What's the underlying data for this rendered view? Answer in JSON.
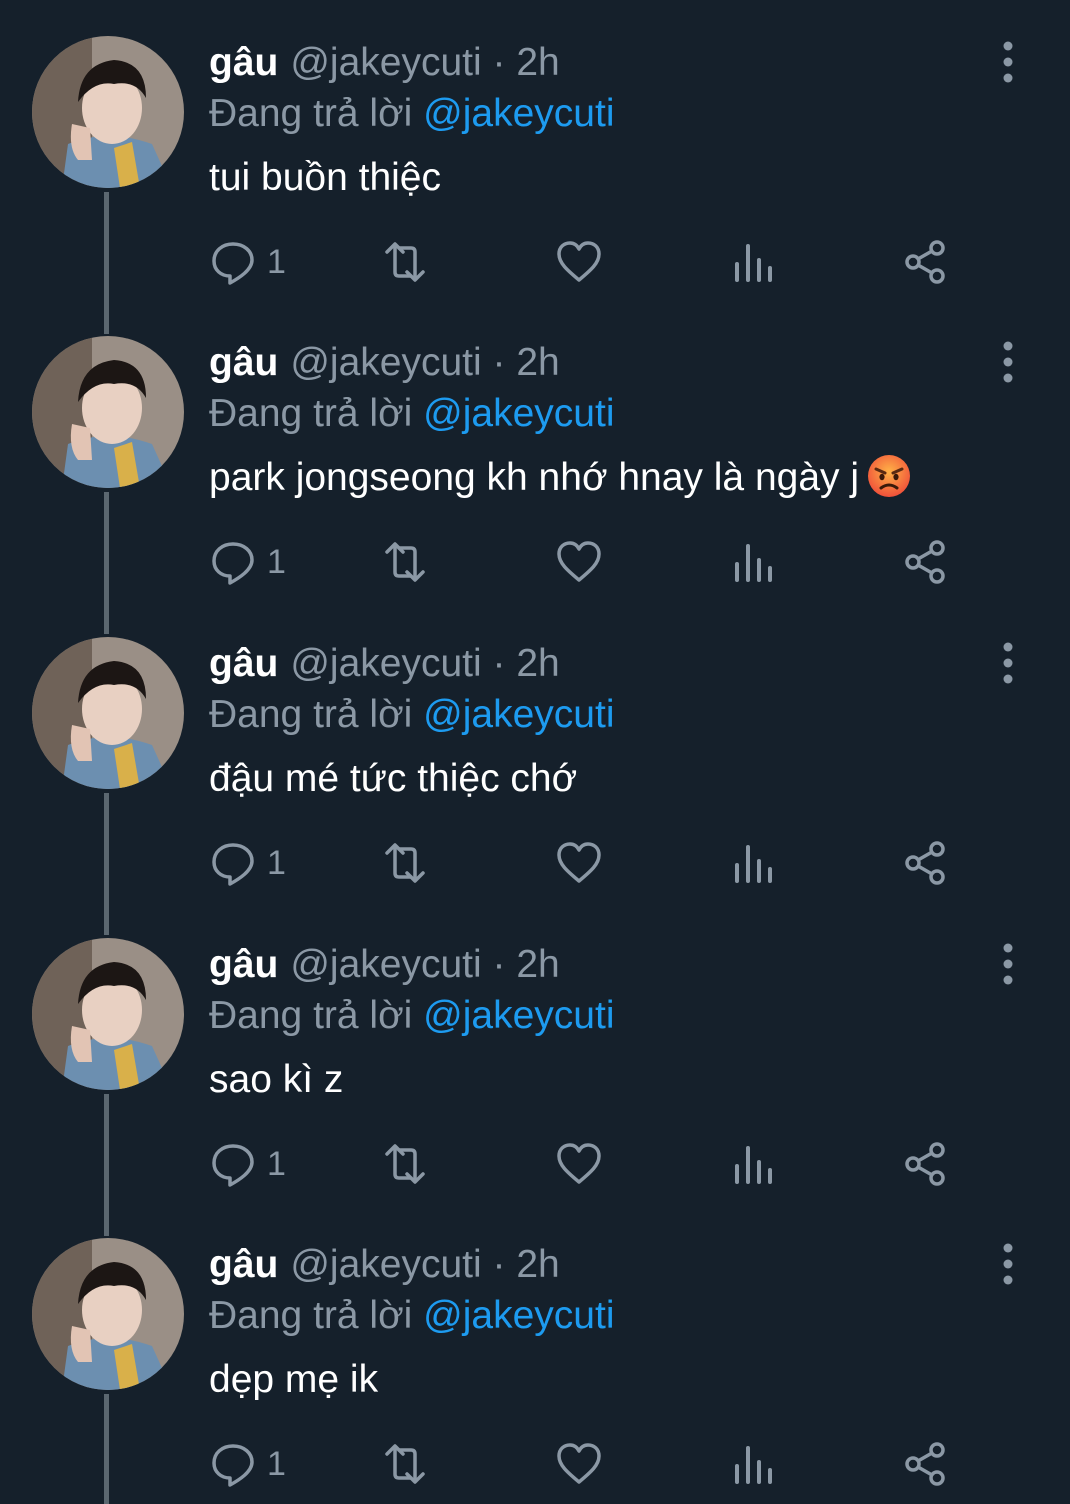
{
  "tweets": [
    {
      "name": "gâu",
      "handle": "@jakeycuti",
      "separator": "·",
      "time": "2h",
      "replying_prefix": "Đang trả lời",
      "replying_to": "@jakeycuti",
      "text": "tui buồn thiệc",
      "reply_count": "1",
      "emoji": ""
    },
    {
      "name": "gâu",
      "handle": "@jakeycuti",
      "separator": "·",
      "time": "2h",
      "replying_prefix": "Đang trả lời",
      "replying_to": "@jakeycuti",
      "text": "park jongseong kh nhớ hnay là ngày j",
      "reply_count": "1",
      "emoji": "angry-face-emoji"
    },
    {
      "name": "gâu",
      "handle": "@jakeycuti",
      "separator": "·",
      "time": "2h",
      "replying_prefix": "Đang trả lời",
      "replying_to": "@jakeycuti",
      "text": "đậu mé tức thiệc chớ",
      "reply_count": "1",
      "emoji": ""
    },
    {
      "name": "gâu",
      "handle": "@jakeycuti",
      "separator": "·",
      "time": "2h",
      "replying_prefix": "Đang trả lời",
      "replying_to": "@jakeycuti",
      "text": "sao kì z",
      "reply_count": "1",
      "emoji": ""
    },
    {
      "name": "gâu",
      "handle": "@jakeycuti",
      "separator": "·",
      "time": "2h",
      "replying_prefix": "Đang trả lời",
      "replying_to": "@jakeycuti",
      "text": "dẹp mẹ ik",
      "reply_count": "1",
      "emoji": ""
    }
  ],
  "icons": {
    "reply": "reply-icon",
    "retweet": "retweet-icon",
    "like": "heart-icon",
    "views": "analytics-icon",
    "share": "share-icon",
    "more": "more-vertical-icon"
  },
  "colors": {
    "background": "#15202b",
    "primary_text": "#ffffff",
    "secondary_text": "#8b98a5",
    "mention": "#1d9bf0",
    "thread_line": "#5b6770"
  }
}
